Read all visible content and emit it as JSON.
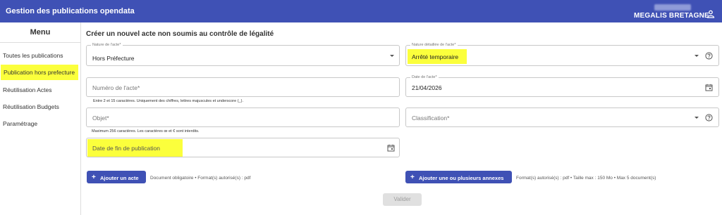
{
  "header": {
    "title": "Gestion des publications opendata",
    "organization": "MEGALIS BRETAGNE"
  },
  "sidebar": {
    "title": "Menu",
    "items": [
      {
        "label": "Toutes les publications"
      },
      {
        "label": "Publication hors prefecture"
      },
      {
        "label": "Réutilisation Actes"
      },
      {
        "label": "Réutilisation Budgets"
      },
      {
        "label": "Paramétrage"
      }
    ]
  },
  "form": {
    "title": "Créer un nouvel acte non soumis au contrôle de légalité",
    "nature": {
      "label": "Nature de l'acte*",
      "value": "Hors Préfecture"
    },
    "nature_detail": {
      "label": "Nature détaillée de l'acte*",
      "value": "Arrêté temporaire"
    },
    "numero": {
      "placeholder": "Numéro de l'acte*",
      "hint": "Entre 2 et 15 caractères. Uniquement des chiffres, lettres majuscules et underscore (_)."
    },
    "date": {
      "label": "Date de l'acte*",
      "value": "21/04/2026"
    },
    "objet": {
      "placeholder": "Objet*",
      "hint": "Maximum 256 caractères. Les caractères œ et € sont interdits."
    },
    "classification": {
      "placeholder": "Classification*"
    },
    "date_fin": {
      "placeholder": "Date de fin de publication"
    },
    "add_act": {
      "label": "Ajouter un acte",
      "note": "Document obligatoire • Format(s) autorisé(s) : pdf"
    },
    "add_annex": {
      "label": "Ajouter une ou plusieurs annexes",
      "note": "Format(s) autorisé(s) : pdf • Taille max : 150 Mo • Max 5 document(s)"
    },
    "submit": {
      "label": "Valider"
    }
  },
  "colors": {
    "primary": "#3f51b5",
    "highlight": "#fbff3c",
    "disabled": "#e0e0e0"
  }
}
